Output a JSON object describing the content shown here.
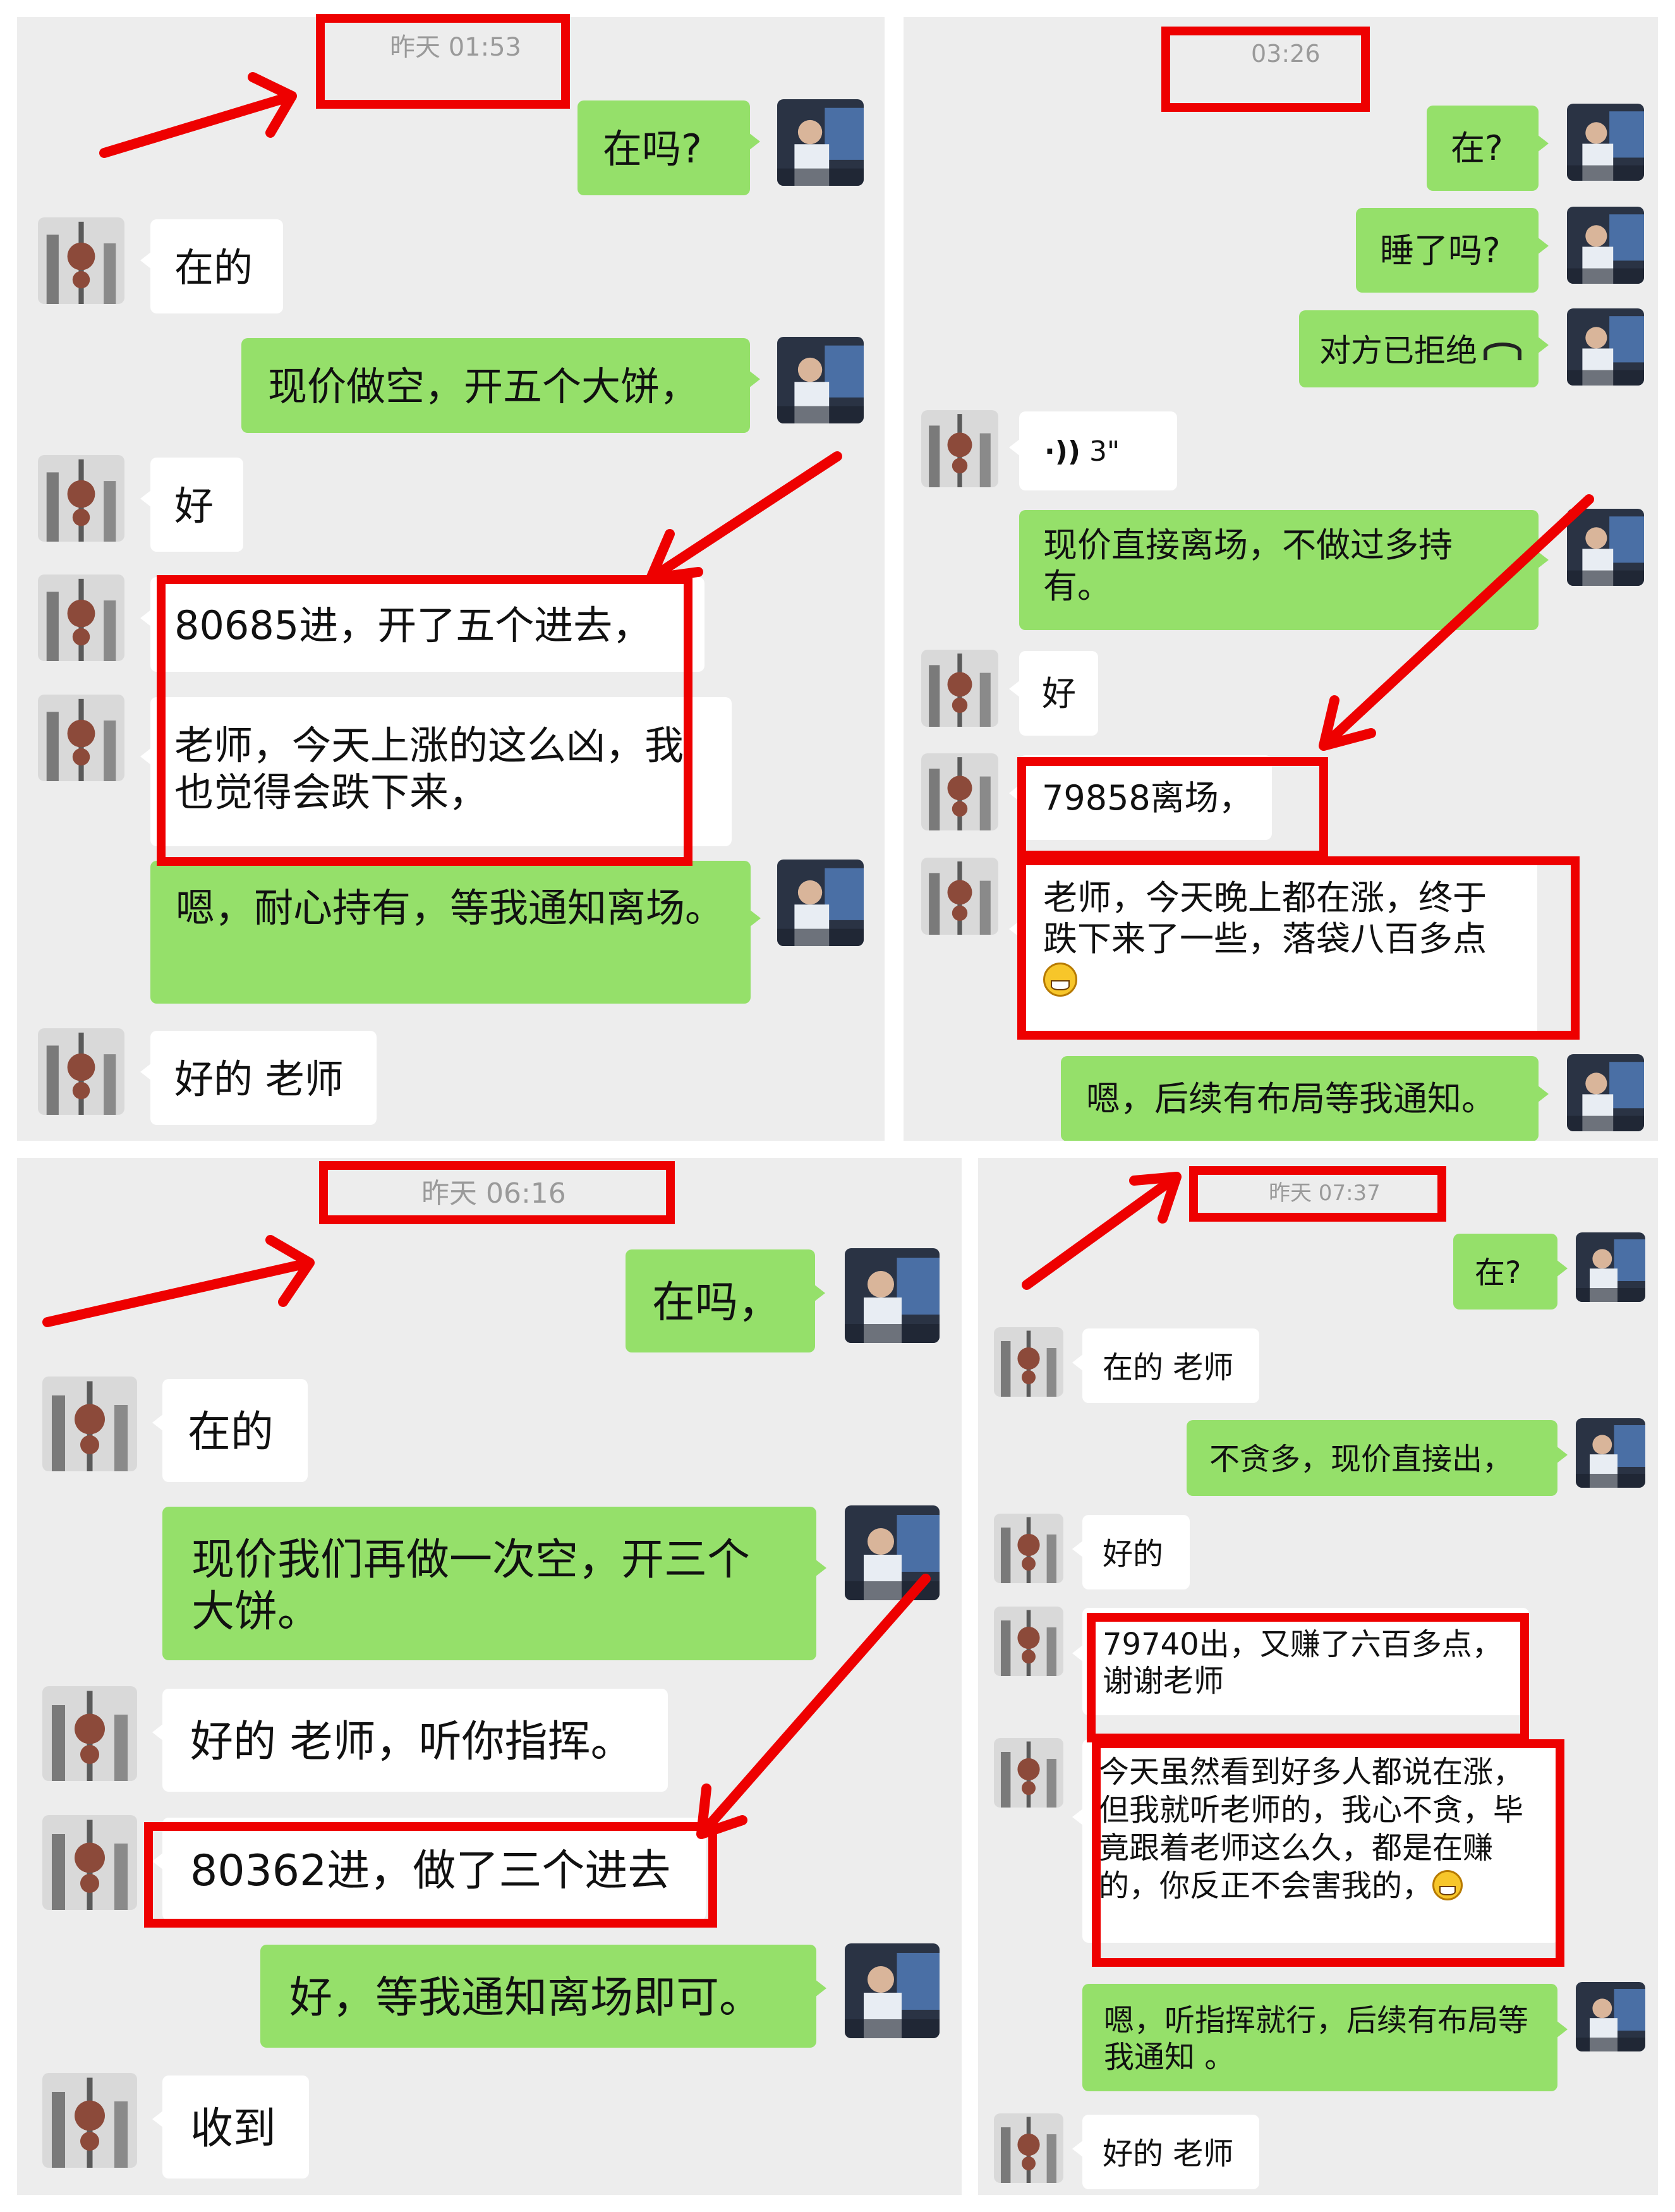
{
  "panels": [
    {
      "timestamp": "昨天 01:53",
      "messages": [
        {
          "side": "me",
          "text": "在吗?"
        },
        {
          "side": "them",
          "text": "在的"
        },
        {
          "side": "me",
          "text": "现价做空，开五个大饼，"
        },
        {
          "side": "them",
          "text": "好"
        },
        {
          "side": "them",
          "text": "80685进，开了五个进去，"
        },
        {
          "side": "them",
          "text": "老师，今天上涨的这么凶，我也觉得会跌下来，"
        },
        {
          "side": "me",
          "text": "嗯，耐心持有，等我通知离场。"
        },
        {
          "side": "them",
          "text": "好的 老师"
        }
      ]
    },
    {
      "timestamp": "03:26",
      "messages": [
        {
          "side": "me",
          "text": "在?"
        },
        {
          "side": "me",
          "text": "睡了吗?"
        },
        {
          "side": "me",
          "text": "对方已拒绝",
          "icon": "hangup-icon"
        },
        {
          "side": "them",
          "text": "3\"",
          "icon": "voice-icon"
        },
        {
          "side": "me",
          "text": "现价直接离场，不做过多持有。"
        },
        {
          "side": "them",
          "text": "好"
        },
        {
          "side": "them",
          "text": "79858离场，"
        },
        {
          "side": "them",
          "text": "老师，今天晚上都在涨，终于跌下来了一些，落袋八百多点",
          "emoji": "grin-emoji"
        },
        {
          "side": "me",
          "text": "嗯，后续有布局等我通知。"
        }
      ]
    },
    {
      "timestamp": "昨天 06:16",
      "messages": [
        {
          "side": "me",
          "text": "在吗，"
        },
        {
          "side": "them",
          "text": "在的"
        },
        {
          "side": "me",
          "text": "现价我们再做一次空，开三个大饼。"
        },
        {
          "side": "them",
          "text": "好的 老师，听你指挥。"
        },
        {
          "side": "them",
          "text": "80362进，做了三个进去"
        },
        {
          "side": "me",
          "text": "好，等我通知离场即可。"
        },
        {
          "side": "them",
          "text": "收到"
        }
      ]
    },
    {
      "timestamp": "昨天 07:37",
      "messages": [
        {
          "side": "me",
          "text": "在?"
        },
        {
          "side": "them",
          "text": "在的 老师"
        },
        {
          "side": "me",
          "text": "不贪多，现价直接出，"
        },
        {
          "side": "them",
          "text": "好的"
        },
        {
          "side": "them",
          "text": "79740出，又赚了六百多点，谢谢老师"
        },
        {
          "side": "them",
          "text": "今天虽然看到好多人都说在涨，但我就听老师的，我心不贪，毕竟跟着老师这么久，都是在赚的，你反正不会害我的，",
          "emoji": "grin-emoji"
        },
        {
          "side": "me",
          "text": "嗯，听指挥就行，后续有布局等我通知 。"
        },
        {
          "side": "them",
          "text": "好的 老师"
        }
      ]
    }
  ],
  "colors": {
    "background": "#ededed",
    "my_bubble": "#95e06a",
    "their_bubble": "#ffffff",
    "highlight": "#ee0000"
  }
}
